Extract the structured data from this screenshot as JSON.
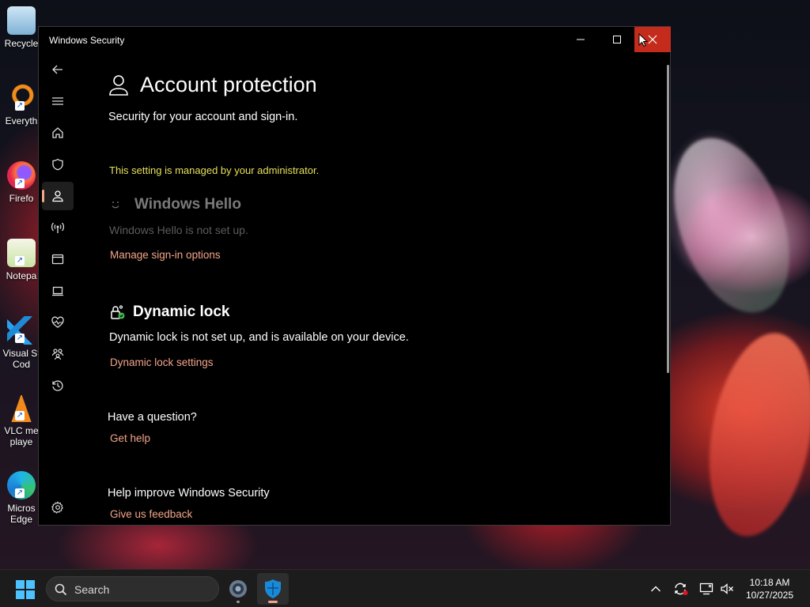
{
  "desktop": {
    "icons": [
      {
        "label": "Recycle",
        "icon": "recycle-bin-icon"
      },
      {
        "label": "Everyth",
        "icon": "everything-search-icon"
      },
      {
        "label": "Firefo",
        "icon": "firefox-icon"
      },
      {
        "label": "Notepa",
        "icon": "notepad-plus-plus-icon"
      },
      {
        "label": "Visual St",
        "label2": "Cod",
        "icon": "vscode-icon"
      },
      {
        "label": "VLC me",
        "label2": "playe",
        "icon": "vlc-icon"
      },
      {
        "label": "Micros",
        "label2": "Edge",
        "icon": "edge-icon"
      }
    ]
  },
  "window": {
    "title": "Windows Security",
    "controls": {
      "minimize": "—",
      "maximize": "☐",
      "close": "✕"
    }
  },
  "nav": {
    "items": [
      {
        "name": "back",
        "icon": "back-arrow-icon"
      },
      {
        "name": "menu",
        "icon": "hamburger-menu-icon"
      },
      {
        "name": "home",
        "icon": "home-icon"
      },
      {
        "name": "virus-threat-protection",
        "icon": "shield-icon"
      },
      {
        "name": "account-protection",
        "icon": "person-icon",
        "active": true
      },
      {
        "name": "firewall-network",
        "icon": "network-antenna-icon"
      },
      {
        "name": "app-browser-control",
        "icon": "app-window-icon"
      },
      {
        "name": "device-security",
        "icon": "laptop-icon"
      },
      {
        "name": "device-performance-health",
        "icon": "heart-pulse-icon"
      },
      {
        "name": "family-options",
        "icon": "family-icon"
      },
      {
        "name": "protection-history",
        "icon": "history-icon"
      }
    ],
    "settings_icon": "gear-icon"
  },
  "page": {
    "title": "Account protection",
    "subtitle": "Security for your account and sign-in.",
    "admin_note": "This setting is managed by your administrator.",
    "windows_hello": {
      "title": "Windows Hello",
      "description": "Windows Hello is not set up.",
      "link": "Manage sign-in options"
    },
    "dynamic_lock": {
      "title": "Dynamic lock",
      "description": "Dynamic lock is not set up, and is available on your device.",
      "link": "Dynamic lock settings"
    },
    "question": {
      "title": "Have a question?",
      "link": "Get help"
    },
    "feedback": {
      "title": "Help improve Windows Security",
      "link": "Give us feedback"
    }
  },
  "taskbar": {
    "search_placeholder": "Search",
    "apps": [
      {
        "name": "settings",
        "icon": "gear-app-icon"
      },
      {
        "name": "windows-security",
        "icon": "windows-security-shield-icon",
        "active": true
      }
    ],
    "tray": [
      "chevron-up-icon",
      "sync-icon",
      "display-icon",
      "speaker-muted-icon"
    ],
    "time": "10:18 AM",
    "date": "10/27/2025"
  },
  "colors": {
    "accent_link": "#f4a58a",
    "admin_note": "#e6e05a",
    "close_button": "#c42b1c",
    "start_blue": "#4cc2ff"
  }
}
